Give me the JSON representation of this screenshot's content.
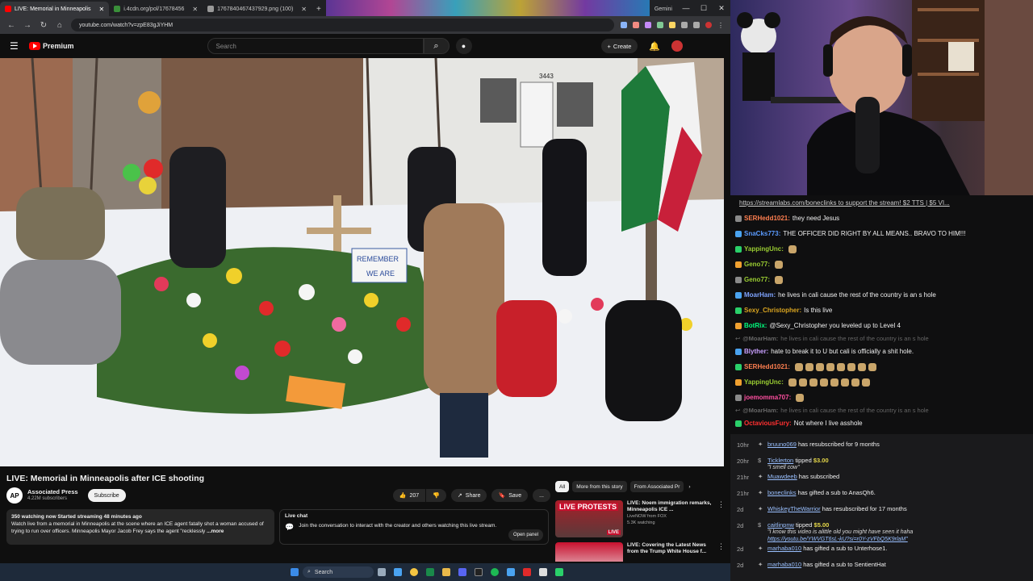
{
  "browser": {
    "tabs": [
      {
        "label": "LIVE: Memorial in Minneapolis",
        "active": true
      },
      {
        "label": "i.4cdn.org/pol/17678456",
        "active": false
      },
      {
        "label": "1767840467437929.png (100)",
        "active": false
      }
    ],
    "new_tab": "+",
    "profile_label": "Gemini",
    "url": "youtube.com/watch?v=zpE83gJiYHM"
  },
  "youtube": {
    "logo": "Premium",
    "search_placeholder": "Search",
    "create_label": "Create"
  },
  "video": {
    "title": "LIVE: Memorial in Minneapolis after ICE shooting",
    "channel": "Associated Press",
    "channel_logo": "AP",
    "subscribers": "4.22M subscribers",
    "subscribe_label": "Subscribe",
    "likes": "207",
    "share_label": "Share",
    "save_label": "Save",
    "more_label": "...",
    "description_stats": "350 watching now  Started streaming 48 minutes ago",
    "description": "Watch live from a memorial in Minneapolis at the scene where an ICE agent fatally shot a woman accused of trying to run over officers. Minneapolis Mayor Jacob Frey says the agent \"recklessly",
    "description_more": "...more",
    "sign_text": "REMEMBER",
    "sign_text2": "WE ARE",
    "house_number": "3443"
  },
  "livechat": {
    "title": "Live chat",
    "text": "Join the conversation to interact with the creator and others watching this live stream.",
    "button": "Open panel"
  },
  "recs": {
    "chips": [
      "All",
      "More from this story",
      "From Associated Pr"
    ],
    "items": [
      {
        "title": "LIVE: Noem immigration remarks, Minneapolis ICE ...",
        "channel": "LiveNOW from FOX",
        "views": "5.3K watching",
        "thumb_text": "LIVE PROTESTS",
        "badge": "LIVE"
      },
      {
        "title": "LIVE: Covering the Latest News from the Trump White House f...",
        "channel": "",
        "views": "",
        "thumb_text": "",
        "badge": ""
      }
    ]
  },
  "taskbar": {
    "search": "Search"
  },
  "chat": {
    "pinned": "https://streamlabs.com/boneclinks to support the stream! $2 TTS | $5 VI...",
    "lines": [
      {
        "user": "SERHedd1021:",
        "color": "#ff7f50",
        "text": "they need Jesus",
        "dim": false
      },
      {
        "user": "SnaCks773:",
        "color": "#5b9bff",
        "text": "THE OFFICER DID RIGHT BY ALL MEANS.. BRAVO TO HIM!!!",
        "dim": false
      },
      {
        "user": "YappingUnc:",
        "color": "#9acd32",
        "text": "",
        "dim": false
      },
      {
        "user": "Geno77:",
        "color": "#9acd32",
        "text": "",
        "dim": false
      },
      {
        "user": "Geno77:",
        "color": "#9acd32",
        "text": "",
        "dim": false
      },
      {
        "user": "MoarHam:",
        "color": "#7fa4ff",
        "text": "he lives in cali cause the rest of the country is an s hole",
        "dim": false
      },
      {
        "user": "Sexy_Christopher:",
        "color": "#daa520",
        "text": "Is this live",
        "dim": false
      },
      {
        "user": "BotRix:",
        "color": "#00ff7f",
        "text": "@Sexy_Christopher you leveled up to Level 4",
        "dim": false
      },
      {
        "user": "@MoarHam:",
        "color": "#666666",
        "text": "he lives in cali cause the rest of the country is an s hole",
        "dim": true
      },
      {
        "user": "Blyther:",
        "color": "#c9a0ff",
        "text": "hate to break it to U but cali is officially a shit hole.",
        "dim": false
      },
      {
        "user": "SERHedd1021:",
        "color": "#ff7f50",
        "text": "",
        "dim": false
      },
      {
        "user": "YappingUnc:",
        "color": "#9acd32",
        "text": "",
        "dim": false
      },
      {
        "user": "joemomma707:",
        "color": "#ff4fa0",
        "text": "",
        "dim": false
      },
      {
        "user": "@MoarHam:",
        "color": "#666666",
        "text": "he lives in cali cause the rest of the country is an s hole",
        "dim": true
      },
      {
        "user": "OctaviousFury:",
        "color": "#ff3030",
        "text": "Not where I live asshole",
        "dim": false
      }
    ]
  },
  "events": [
    {
      "time": "10hr",
      "name": "bruuno069",
      "text": "has resubscribed for 9 months",
      "amount": "",
      "msg": "",
      "link": ""
    },
    {
      "time": "20hr",
      "name": "Ticklerton",
      "text": "tipped",
      "amount": "$3.00",
      "msg": "\"I smell cow\"",
      "link": ""
    },
    {
      "time": "21hr",
      "name": "Muawdeeb",
      "text": "has subscribed",
      "amount": "",
      "msg": "",
      "link": ""
    },
    {
      "time": "21hr",
      "name": "boneclinks",
      "text": "has gifted a sub to AnasQh6.",
      "amount": "",
      "msg": "",
      "link": ""
    },
    {
      "time": "2d",
      "name": "WhiskeyTheWarrior",
      "text": "has resubscribed for 17 months",
      "amount": "",
      "msg": "",
      "link": ""
    },
    {
      "time": "2d",
      "name": "caitlinpnw",
      "text": "tipped",
      "amount": "$5.00",
      "msg": "\"I know this video is alittle old you might have seen it haha",
      "link": "https://youtu.be/YWVGT6sL-kU?si=r0Y-zVFbQ5K9rlaM\""
    },
    {
      "time": "2d",
      "name": "marhaba010",
      "text": "has gifted a sub to Unterhose1.",
      "amount": "",
      "msg": "",
      "link": ""
    },
    {
      "time": "2d",
      "name": "marhaba010",
      "text": "has gifted a sub to SentientHat",
      "amount": "",
      "msg": "",
      "link": ""
    }
  ]
}
